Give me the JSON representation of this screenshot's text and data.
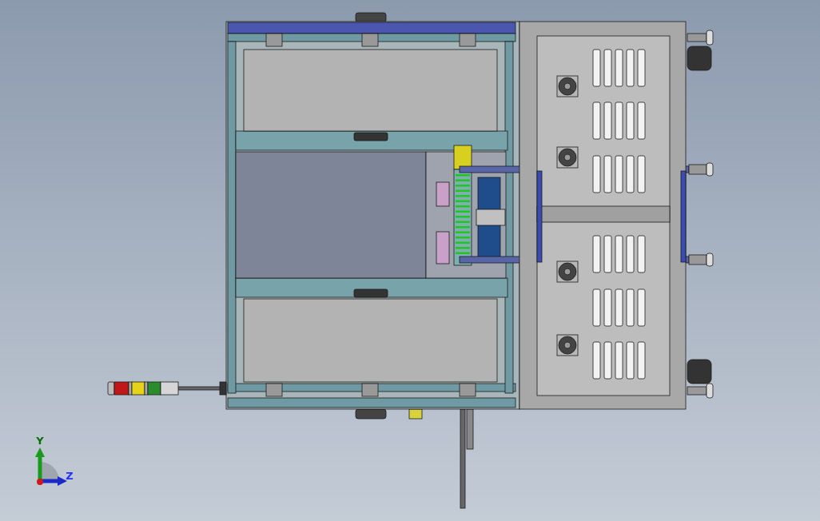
{
  "viewport": {
    "triad": {
      "axes": [
        {
          "kind": "y",
          "label": "Y"
        },
        {
          "kind": "z",
          "label": "Z"
        }
      ]
    }
  }
}
